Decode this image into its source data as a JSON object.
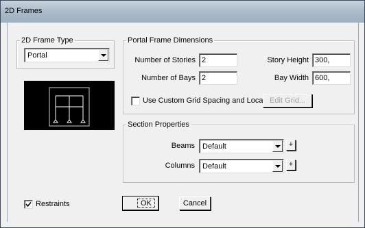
{
  "window": {
    "title": "2D Frames"
  },
  "frame_type": {
    "legend": "2D Frame Type",
    "selected": "Portal"
  },
  "portal_dims": {
    "legend": "Portal Frame Dimensions",
    "stories_label": "Number of Stories",
    "stories_value": "2",
    "bays_label": "Number of Bays",
    "bays_value": "2",
    "story_height_label": "Story Height",
    "story_height_value": "300,",
    "bay_width_label": "Bay Width",
    "bay_width_value": "600,",
    "custom_grid_label": "Use Custom Grid Spacing and Locate Origin",
    "custom_grid_checked": false,
    "edit_grid_label": "Edit Grid..."
  },
  "section": {
    "legend": "Section Properties",
    "beams_label": "Beams",
    "beams_value": "Default",
    "columns_label": "Columns",
    "columns_value": "Default",
    "plus_label": "+"
  },
  "restraints": {
    "label": "Restraints",
    "checked": true
  },
  "buttons": {
    "ok": "OK",
    "cancel": "Cancel"
  },
  "colors": {
    "preview_bg": "#000000",
    "frame_lines": "#ffffff"
  }
}
